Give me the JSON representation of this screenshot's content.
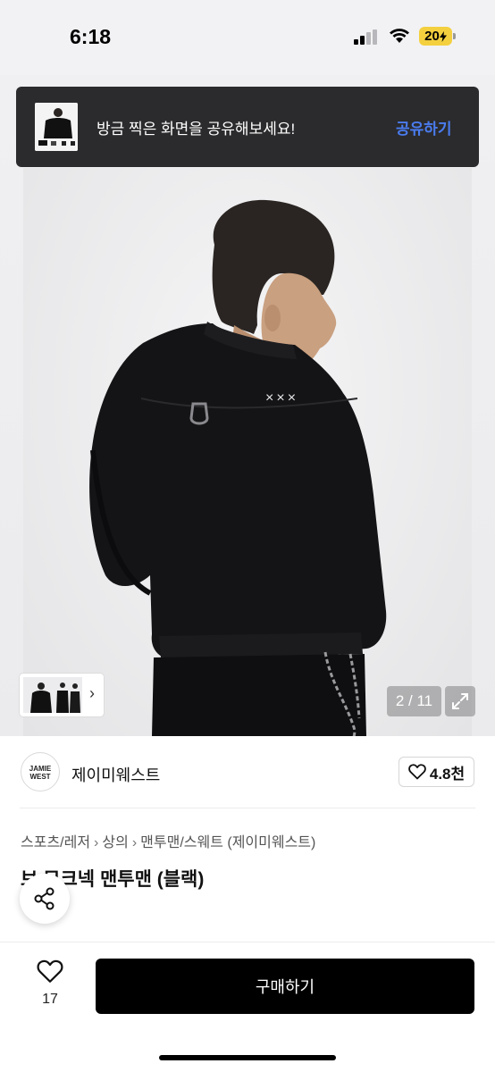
{
  "status_bar": {
    "time": "6:18",
    "battery": "20"
  },
  "share_toast": {
    "message": "방금 찍은 화면을 공유해보세요!",
    "action": "공유하기"
  },
  "gallery": {
    "counter": "2 / 11"
  },
  "shop": {
    "logo_text": "JAMIE WEST",
    "name": "제이미웨스트",
    "likes": "4.8천"
  },
  "breadcrumb": [
    "스포츠/레저",
    "상의",
    "맨투맨/스웨트",
    "(제이미웨스트)"
  ],
  "product": {
    "title": "브 모크넥 맨투맨 (블랙)"
  },
  "bottom_bar": {
    "wish_count": "17",
    "buy_label": "구매하기"
  }
}
